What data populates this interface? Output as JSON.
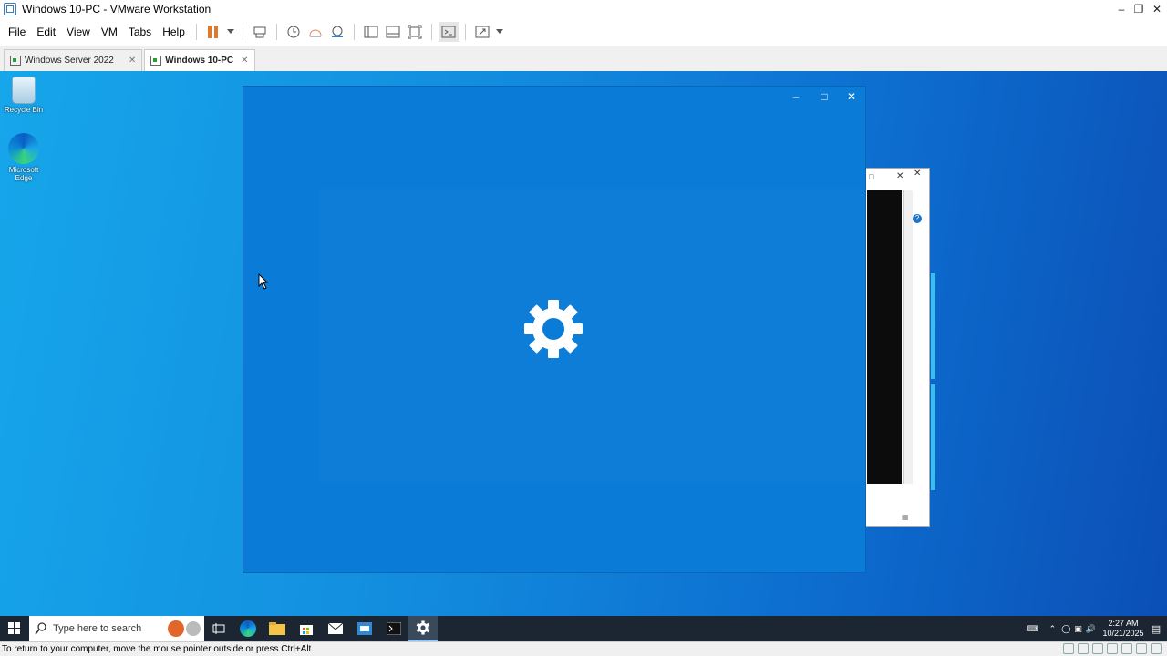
{
  "window": {
    "title": "Windows 10-PC - VMware Workstation"
  },
  "menu": {
    "file": "File",
    "edit": "Edit",
    "view": "View",
    "vm": "VM",
    "tabs": "Tabs",
    "help": "Help"
  },
  "tabs": [
    {
      "label": "Windows Server 2022",
      "active": false
    },
    {
      "label": "Windows 10-PC",
      "active": true
    }
  ],
  "desktop": {
    "icons": [
      {
        "label": "Recycle Bin"
      },
      {
        "label": "Microsoft Edge"
      }
    ]
  },
  "taskbar": {
    "search_placeholder": "Type here to search",
    "clock_time": "2:27 AM",
    "clock_date": "10/21/2025"
  },
  "statusbar": {
    "text": "To return to your computer, move the mouse pointer outside or press Ctrl+Alt."
  },
  "colors": {
    "accent": "#0a7bd7",
    "taskbar": "#1b2632",
    "pause": "#e07a2a"
  }
}
